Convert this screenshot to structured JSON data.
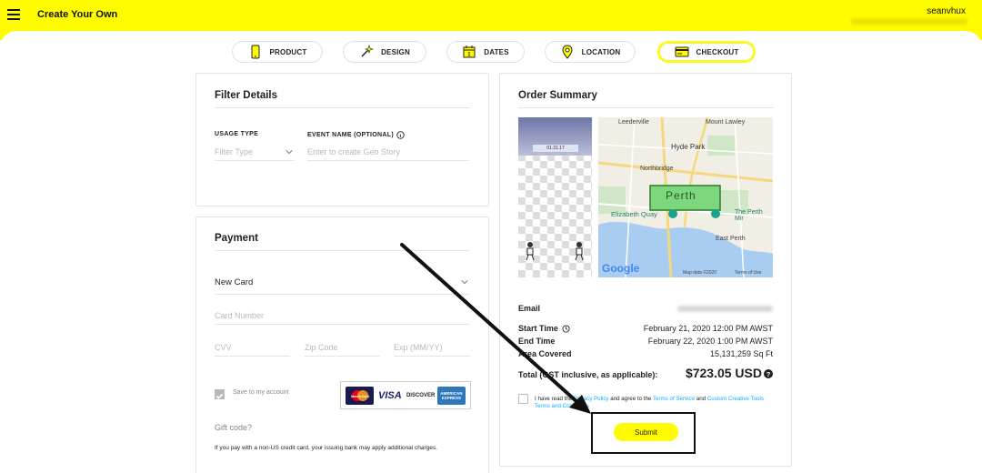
{
  "header": {
    "title": "Create Your Own",
    "username": "seanvhux"
  },
  "steps": [
    {
      "label": "PRODUCT",
      "icon": "phone-icon"
    },
    {
      "label": "DESIGN",
      "icon": "magic-wand-icon"
    },
    {
      "label": "DATES",
      "icon": "calendar-icon"
    },
    {
      "label": "LOCATION",
      "icon": "location-pin-icon"
    },
    {
      "label": "CHECKOUT",
      "icon": "credit-card-icon",
      "active": true
    }
  ],
  "filter_details": {
    "title": "Filter Details",
    "usage_type_label": "USAGE TYPE",
    "usage_type_placeholder": "Filter Type",
    "event_name_label": "EVENT NAME (OPTIONAL)",
    "event_name_placeholder": "Enter to create Geo Story"
  },
  "payment": {
    "title": "Payment",
    "card_select": "New Card",
    "card_number_placeholder": "Card Number",
    "cvv_placeholder": "CVV",
    "zip_placeholder": "Zip Code",
    "exp_placeholder": "Exp (MM/YY)",
    "save_label": "Save to my account",
    "save_checked": true,
    "card_logos": [
      "MasterCard",
      "VISA",
      "DISCOVER",
      "AMERICAN EXPRESS"
    ],
    "gift_code": "Gift code?",
    "notice": "If you pay with a non-US credit card, your issuing bank may apply additional charges."
  },
  "order_summary": {
    "title": "Order Summary",
    "filter_preview_date": "01.31.17",
    "map": {
      "labels": [
        "Leederville",
        "Mount Lawley",
        "Hyde Park",
        "Northbridge",
        "Perth",
        "Elizabeth Quay",
        "The Perth Mir",
        "East Perth"
      ],
      "google": "Google",
      "map_data": "Map data ©2020",
      "terms": "Terms of Use"
    },
    "email_label": "Email",
    "start_time_label": "Start Time",
    "start_time_value": "February 21, 2020 12:00 PM  AWST",
    "end_time_label": "End Time",
    "end_time_value": "February 22, 2020 1:00 PM  AWST",
    "area_label": "Area Covered",
    "area_value": "15,131,259 Sq Ft",
    "total_label": "Total (GST inclusive, as applicable):",
    "total_value": "$723.05 USD",
    "agree_prefix": "I have read the",
    "privacy_link": "Privacy Policy",
    "agree_mid": "and agree to the",
    "terms_link": "Terms of Service",
    "agree_and": "and",
    "creative_link": "Custom Creative Tools Terms and Conditions",
    "submit_label": "Submit"
  },
  "colors": {
    "brand_yellow": "#fffc00",
    "link_blue": "#0eadff",
    "map_highlight": "#7dd87d"
  }
}
